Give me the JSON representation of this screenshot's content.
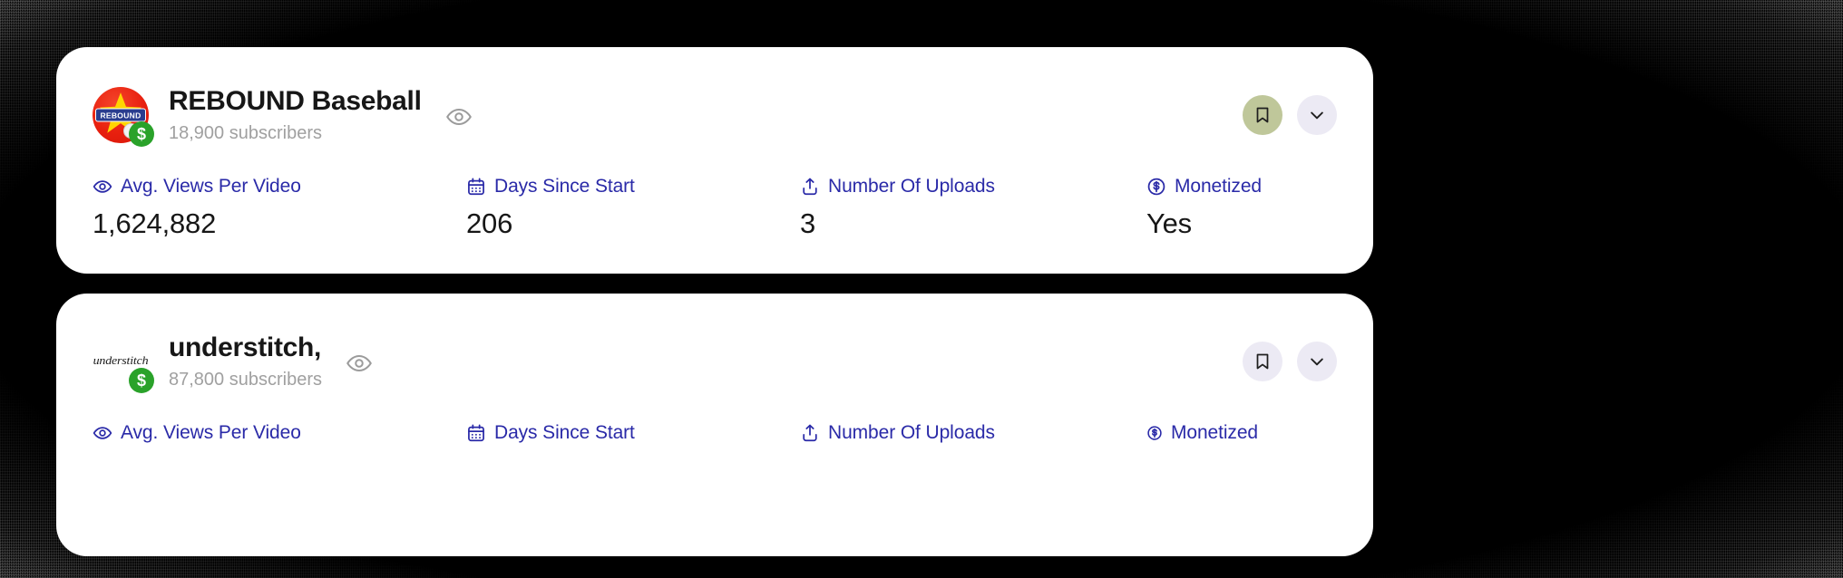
{
  "theme": {
    "accent_label": "#2A2AA8",
    "value_text": "#171717",
    "sub_text": "#A0A0A0",
    "card_bg": "#FFFFFF",
    "btn_bg": "#ECEAF4",
    "btn_saved_bg": "#BFC79A",
    "money_badge": "#2AA22A",
    "page_bg": "#000000"
  },
  "metric_labels": {
    "avg_views": "Avg. Views Per Video",
    "days_since_start": "Days Since Start",
    "number_of_uploads": "Number Of Uploads",
    "monetized": "Monetized"
  },
  "icons": {
    "avg_views": "eye-icon",
    "days_since_start": "calendar-icon",
    "number_of_uploads": "upload-icon",
    "monetized": "dollar-circle-icon",
    "preview": "eye-outline-icon",
    "bookmark": "bookmark-icon",
    "expand": "chevron-down-icon",
    "money_badge": "dollar-sign-badge"
  },
  "cards": [
    {
      "id": "rebound-baseball",
      "title": "REBOUND Baseball",
      "subscribers": "18,900 subscribers",
      "avatar": {
        "type": "rebound-logo",
        "wordmark": "REBOUND",
        "badge_symbol": "$"
      },
      "bookmark_saved": true,
      "metrics": [
        {
          "key": "avg_views",
          "label": "Avg. Views Per Video",
          "icon": "eye-icon",
          "value": "1,624,882"
        },
        {
          "key": "days_since_start",
          "label": "Days Since Start",
          "icon": "calendar-icon",
          "value": "206"
        },
        {
          "key": "number_of_uploads",
          "label": "Number Of Uploads",
          "icon": "upload-icon",
          "value": "3"
        },
        {
          "key": "monetized",
          "label": "Monetized",
          "icon": "dollar-circle-icon",
          "value": "Yes"
        }
      ]
    },
    {
      "id": "understitch",
      "title": "understitch,",
      "subscribers": "87,800 subscribers",
      "avatar": {
        "type": "script-wordmark",
        "wordmark": "understitch",
        "badge_symbol": "$"
      },
      "bookmark_saved": false,
      "metrics": [
        {
          "key": "avg_views",
          "label": "Avg. Views Per Video",
          "icon": "eye-icon",
          "value": ""
        },
        {
          "key": "days_since_start",
          "label": "Days Since Start",
          "icon": "calendar-icon",
          "value": ""
        },
        {
          "key": "number_of_uploads",
          "label": "Number Of Uploads",
          "icon": "upload-icon",
          "value": ""
        },
        {
          "key": "monetized",
          "label": "Monetized",
          "icon": "dollar-circle-icon",
          "value": ""
        }
      ]
    }
  ]
}
